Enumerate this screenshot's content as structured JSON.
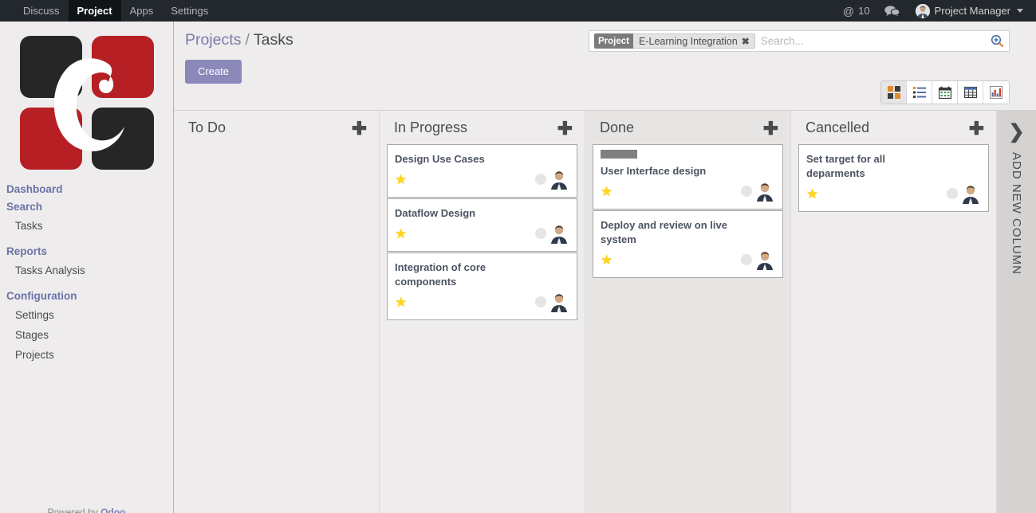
{
  "topbar": {
    "menu": [
      {
        "label": "Discuss",
        "active": false
      },
      {
        "label": "Project",
        "active": true
      },
      {
        "label": "Apps",
        "active": false
      },
      {
        "label": "Settings",
        "active": false
      }
    ],
    "mentions_icon": "at-icon",
    "mentions_count": "10",
    "chat_icon": "chat-bubble-icon",
    "user_name": "Project Manager",
    "user_caret_icon": "caret-down-icon"
  },
  "sidebar": {
    "logo_alt": "company-logo",
    "sections": [
      {
        "type": "head",
        "label": "Dashboard"
      },
      {
        "type": "head",
        "label": "Search"
      },
      {
        "type": "link",
        "label": "Tasks"
      },
      {
        "type": "gap"
      },
      {
        "type": "head",
        "label": "Reports"
      },
      {
        "type": "link",
        "label": "Tasks Analysis"
      },
      {
        "type": "gap"
      },
      {
        "type": "head",
        "label": "Configuration"
      },
      {
        "type": "link",
        "label": "Settings"
      },
      {
        "type": "link",
        "label": "Stages"
      },
      {
        "type": "link",
        "label": "Projects"
      }
    ],
    "powered_prefix": "Powered by ",
    "powered_brand": "Odoo"
  },
  "control_panel": {
    "breadcrumb_root": "Projects",
    "breadcrumb_sep": "/",
    "breadcrumb_current": "Tasks",
    "create_label": "Create"
  },
  "search": {
    "facet_category": "Project",
    "facet_value": "E-Learning Integration",
    "facet_remove_icon": "close-icon",
    "placeholder": "Search...",
    "value": "",
    "search_icon": "search-zoom-icon"
  },
  "view_switcher": {
    "views": [
      {
        "name": "kanban-view",
        "icon": "kanban-icon",
        "active": true
      },
      {
        "name": "list-view",
        "icon": "list-icon",
        "active": false
      },
      {
        "name": "calendar-view",
        "icon": "calendar-icon",
        "active": false
      },
      {
        "name": "pivot-view",
        "icon": "pivot-table-icon",
        "active": false
      },
      {
        "name": "graph-view",
        "icon": "bar-chart-icon",
        "active": false
      }
    ]
  },
  "kanban": {
    "add_icon": "plus-icon",
    "columns": [
      {
        "title": "To Do",
        "tinted": false,
        "cards": []
      },
      {
        "title": "In Progress",
        "tinted": false,
        "cards": [
          {
            "title": "Design Use Cases",
            "star": "★",
            "tag": false,
            "avatar": "user-avatar"
          },
          {
            "title": "Dataflow Design",
            "star": "★",
            "tag": false,
            "avatar": "user-avatar"
          },
          {
            "title": "Integration of core components",
            "star": "★",
            "tag": false,
            "avatar": "user-avatar"
          }
        ]
      },
      {
        "title": "Done",
        "tinted": true,
        "cards": [
          {
            "title": "User Interface design",
            "star": "★",
            "tag": true,
            "avatar": "user-avatar"
          },
          {
            "title": "Deploy and review on live system",
            "star": "★",
            "tag": false,
            "avatar": "user-avatar"
          }
        ]
      },
      {
        "title": "Cancelled",
        "tinted": false,
        "cards": [
          {
            "title": "Set target for all deparments",
            "star": "★",
            "tag": false,
            "avatar": "user-avatar"
          }
        ]
      }
    ],
    "add_column": {
      "chevron_icon": "chevron-right-icon",
      "label": "ADD NEW COLUMN"
    }
  },
  "colors": {
    "topbar_bg": "#22282c",
    "accent_purple": "#7c7bad",
    "create_btn": "#8a89ba",
    "star_yellow": "#ffd519",
    "logo_red": "#b62025",
    "logo_dark": "#262626",
    "column_tint": "#e7e5e3",
    "page_bg": "#eeeced"
  }
}
